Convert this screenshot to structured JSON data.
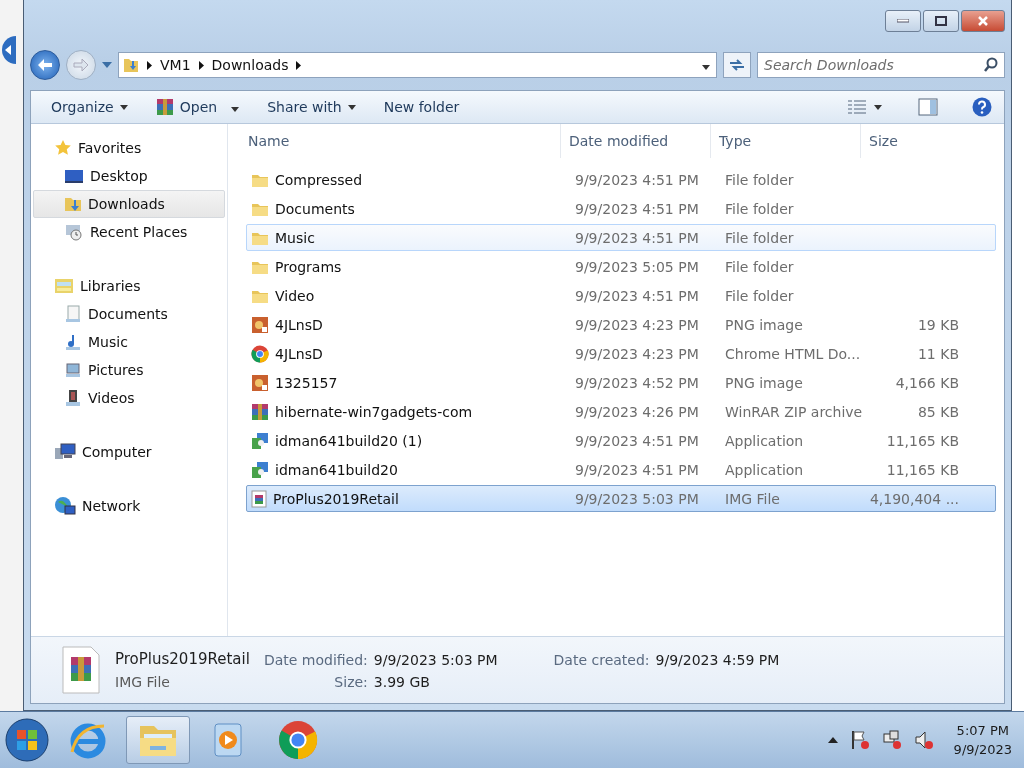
{
  "address": {
    "segments": [
      "VM1",
      "Downloads"
    ]
  },
  "search": {
    "placeholder": "Search Downloads"
  },
  "toolbar": {
    "buttons": [
      {
        "label": "Organize",
        "kind": "menu"
      },
      {
        "label": "Open",
        "kind": "open"
      },
      {
        "label": "Share with",
        "kind": "menu"
      },
      {
        "label": "New folder",
        "kind": "plain"
      }
    ]
  },
  "nav": [
    {
      "label": "Favorites",
      "kind": "star",
      "selected": false,
      "children": [
        {
          "label": "Desktop",
          "kind": "desktop",
          "selected": false
        },
        {
          "label": "Downloads",
          "kind": "downloads",
          "selected": true
        },
        {
          "label": "Recent Places",
          "kind": "recent",
          "selected": false
        }
      ]
    },
    {
      "label": "Libraries",
      "kind": "library",
      "selected": false,
      "children": [
        {
          "label": "Documents",
          "kind": "documents",
          "selected": false
        },
        {
          "label": "Music",
          "kind": "music",
          "selected": false
        },
        {
          "label": "Pictures",
          "kind": "pictures",
          "selected": false
        },
        {
          "label": "Videos",
          "kind": "videos",
          "selected": false
        }
      ]
    },
    {
      "label": "Computer",
      "kind": "computer",
      "selected": false
    },
    {
      "label": "Network",
      "kind": "network",
      "selected": false
    }
  ],
  "table": {
    "columns": [
      "Name",
      "Date modified",
      "Type",
      "Size"
    ],
    "rows": [
      {
        "name": "Compressed",
        "date": "9/9/2023 4:51 PM",
        "type": "File folder",
        "kind": "folder",
        "selected": false,
        "hovered": false
      },
      {
        "name": "Documents",
        "date": "9/9/2023 4:51 PM",
        "type": "File folder",
        "kind": "folder",
        "selected": false,
        "hovered": false
      },
      {
        "name": "Music",
        "date": "9/9/2023 4:51 PM",
        "type": "File folder",
        "kind": "folder",
        "selected": false,
        "hovered": true
      },
      {
        "name": "Programs",
        "date": "9/9/2023 5:05 PM",
        "type": "File folder",
        "kind": "folder",
        "selected": false,
        "hovered": false
      },
      {
        "name": "Video",
        "date": "9/9/2023 4:51 PM",
        "type": "File folder",
        "kind": "folder",
        "selected": false,
        "hovered": false
      },
      {
        "name": "4JLnsD",
        "date": "9/9/2023 4:23 PM",
        "type": "PNG image",
        "size": "19 KB",
        "kind": "image",
        "selected": false,
        "hovered": false
      },
      {
        "name": "4JLnsD",
        "date": "9/9/2023 4:23 PM",
        "type": "Chrome HTML Do...",
        "size": "11 KB",
        "kind": "chrome",
        "selected": false,
        "hovered": false
      },
      {
        "name": "1325157",
        "date": "9/9/2023 4:52 PM",
        "type": "PNG image",
        "size": "4,166 KB",
        "kind": "image",
        "selected": false,
        "hovered": false
      },
      {
        "name": "hibernate-win7gadgets-com",
        "date": "9/9/2023 4:26 PM",
        "type": "WinRAR ZIP archive",
        "size": "85 KB",
        "kind": "archive",
        "selected": false,
        "hovered": false
      },
      {
        "name": "idman641build20 (1)",
        "date": "9/9/2023 4:51 PM",
        "type": "Application",
        "size": "11,165 KB",
        "kind": "app",
        "selected": false,
        "hovered": false
      },
      {
        "name": "idman641build20",
        "date": "9/9/2023 4:51 PM",
        "type": "Application",
        "size": "11,165 KB",
        "kind": "app",
        "selected": false,
        "hovered": false
      },
      {
        "name": "ProPlus2019Retail",
        "date": "9/9/2023 5:03 PM",
        "type": "IMG File",
        "size": "4,190,404 ...",
        "kind": "disc",
        "selected": true,
        "hovered": false
      }
    ]
  },
  "details": {
    "name": "ProPlus2019Retail",
    "type": "IMG File",
    "fields": [
      {
        "label": "Date modified:",
        "value": "9/9/2023 5:03 PM"
      },
      {
        "label": "Size:",
        "value": "3.99 GB"
      },
      {
        "label": "Date created:",
        "value": "9/9/2023 4:59 PM"
      }
    ]
  },
  "taskbar": {
    "apps": [
      {
        "kind": "ie",
        "selected": false
      },
      {
        "kind": "explorer",
        "selected": true
      },
      {
        "kind": "media",
        "selected": false
      },
      {
        "kind": "chrome",
        "selected": false
      }
    ],
    "time": "5:07 PM",
    "date": "9/9/2023"
  }
}
